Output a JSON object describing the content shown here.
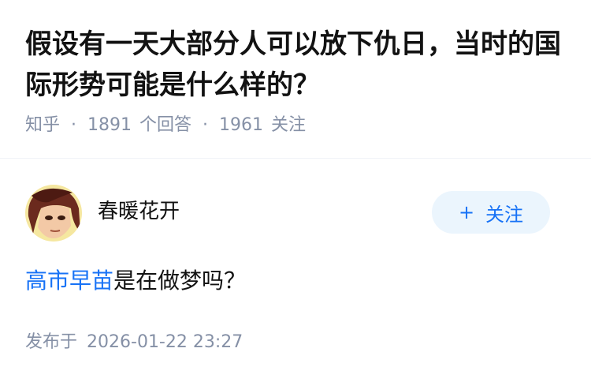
{
  "question": {
    "title": "假设有一天大部分人可以放下仇日，当时的国际形势可能是什么样的？",
    "source": "知乎",
    "answer_count": "1891",
    "answer_count_label": "个回答",
    "follower_count": "1961",
    "follower_label": "关注"
  },
  "author": {
    "name": "春暖花开",
    "follow_plus": "+",
    "follow_label": "关注"
  },
  "answer": {
    "topic_link": "高市早苗",
    "text": "是在做梦吗？"
  },
  "published": {
    "label": "发布于",
    "time": "2026-01-22 23:27"
  },
  "colors": {
    "accent": "#1772f6",
    "meta_gray": "#8590a6",
    "follow_bg": "#ebf5fd"
  }
}
